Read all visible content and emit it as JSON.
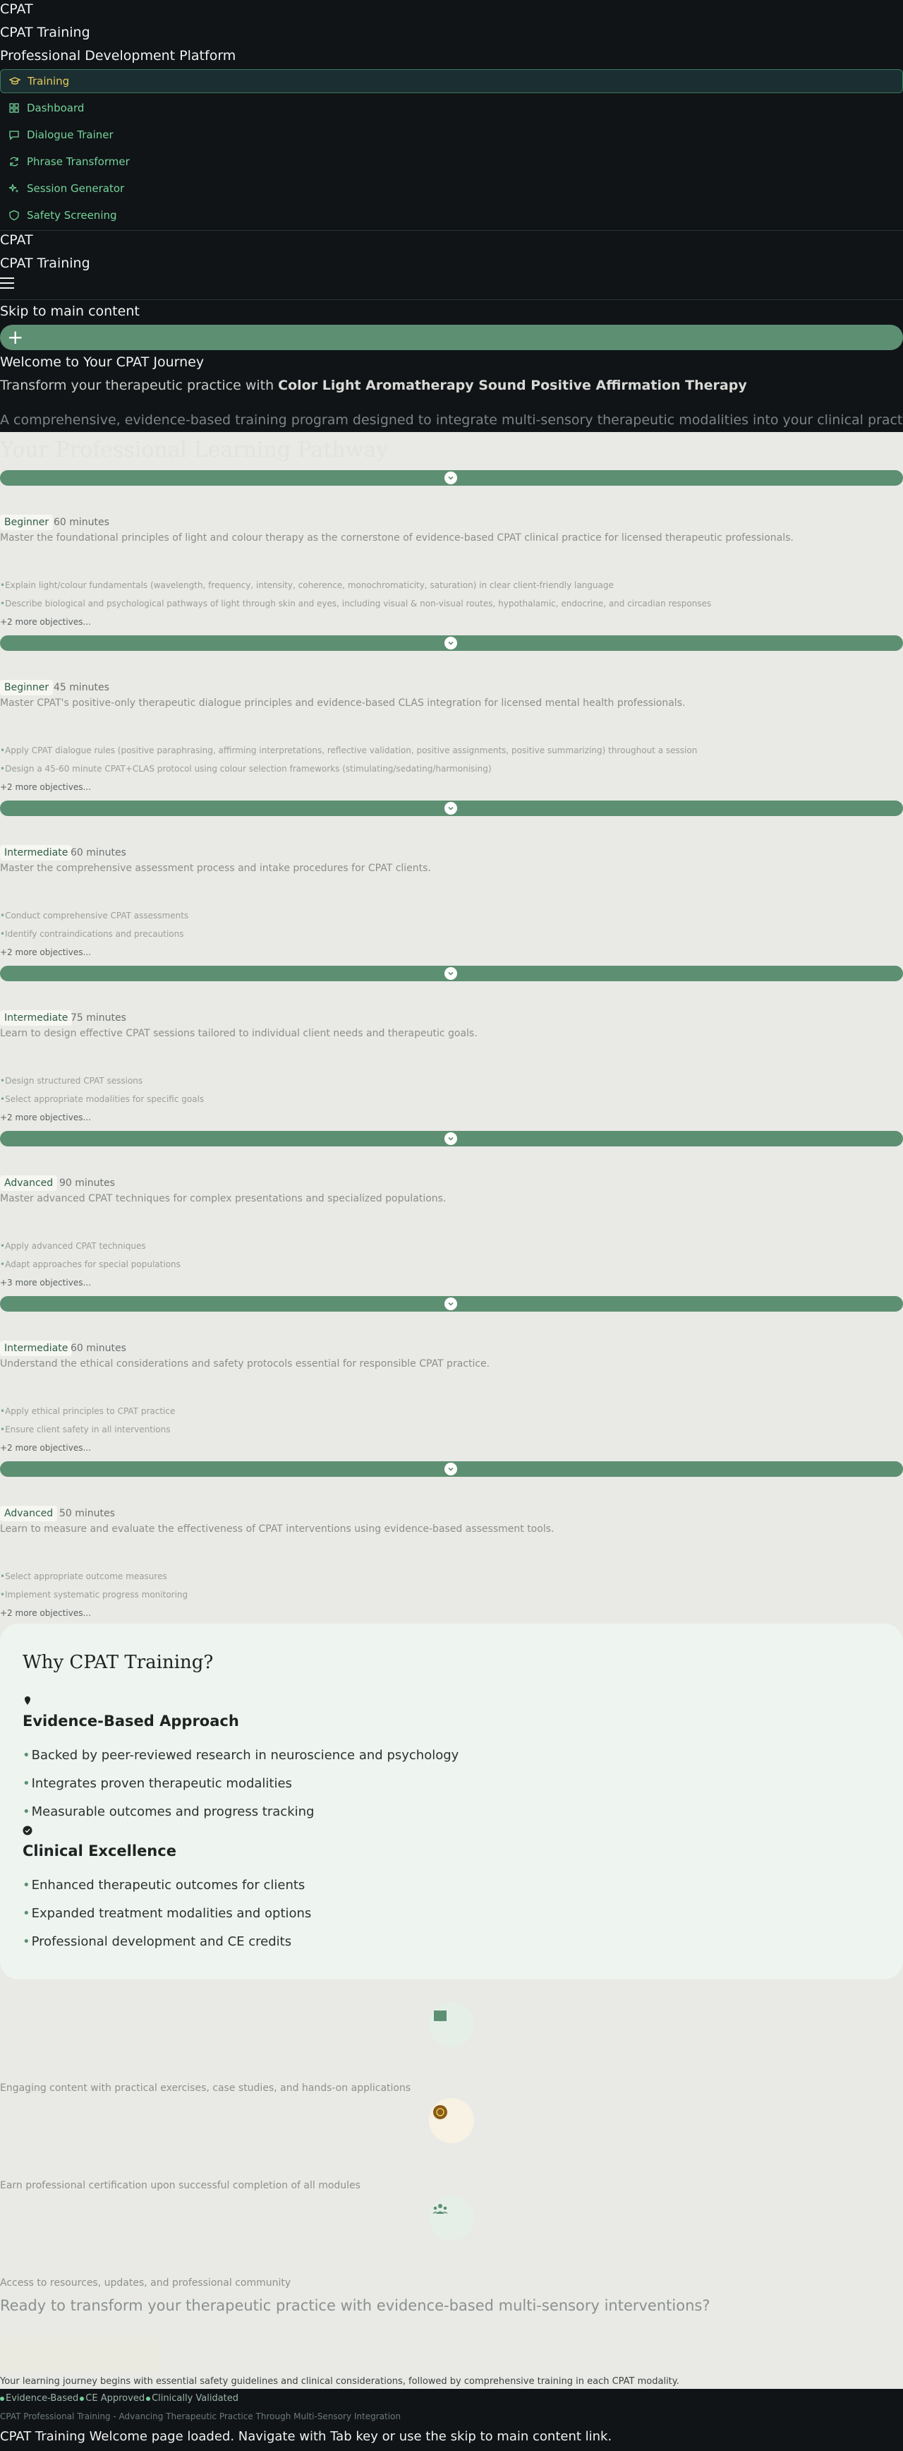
{
  "sidebar": {
    "brand": "CPAT",
    "title": "CPAT Training",
    "subtitle": "Professional Development Platform",
    "nav": [
      {
        "label": "Training",
        "icon": "graduation-cap-icon",
        "active": true
      },
      {
        "label": "Dashboard",
        "icon": "dashboard-grid-icon",
        "active": false
      },
      {
        "label": "Dialogue Trainer",
        "icon": "chat-bubble-icon",
        "active": false
      },
      {
        "label": "Phrase Transformer",
        "icon": "refresh-icon",
        "active": false
      },
      {
        "label": "Session Generator",
        "icon": "sparkles-icon",
        "active": false
      },
      {
        "label": "Safety Screening",
        "icon": "shield-icon",
        "active": false
      }
    ]
  },
  "header": {
    "brand": "CPAT",
    "title": "CPAT Training",
    "menu_icon": "hamburger-icon"
  },
  "skip_link": "Skip to main content",
  "hero": {
    "add_icon": "plus-icon",
    "title": "Welcome to Your CPAT Journey",
    "subtitle_prefix": "Transform your therapeutic practice with ",
    "subtitle_strong": "Color Light Aromatherapy Sound Positive Affirmation Therapy",
    "description": "A comprehensive, evidence-based training program designed to integrate multi-sensory therapeutic modalities into your clinical practice",
    "section_heading": "Your Professional Learning Pathway"
  },
  "modules": [
    {
      "level": "Beginner",
      "duration": "60 minutes",
      "description": "Master the foundational principles of light and colour therapy as the cornerstone of evidence-based CPAT clinical practice for licensed therapeutic professionals.",
      "objectives": [
        "Explain light/colour fundamentals (wavelength, frequency, intensity, coherence, monochromaticity, saturation) in clear client-friendly language",
        "Describe biological and psychological pathways of light through skin and eyes, including visual & non-visual routes, hypothalamic, endocrine, and circadian responses"
      ],
      "more": "+2 more objectives..."
    },
    {
      "level": "Beginner",
      "duration": "45 minutes",
      "description": "Master CPAT's positive-only therapeutic dialogue principles and evidence-based CLAS integration for licensed mental health professionals.",
      "objectives": [
        "Apply CPAT dialogue rules (positive paraphrasing, affirming interpretations, reflective validation, positive assignments, positive summarizing) throughout a session",
        "Design a 45-60 minute CPAT+CLAS protocol using colour selection frameworks (stimulating/sedating/harmonising)"
      ],
      "more": "+2 more objectives..."
    },
    {
      "level": "Intermediate",
      "duration": "60 minutes",
      "description": "Master the comprehensive assessment process and intake procedures for CPAT clients.",
      "objectives": [
        "Conduct comprehensive CPAT assessments",
        "Identify contraindications and precautions"
      ],
      "more": "+2 more objectives..."
    },
    {
      "level": "Intermediate",
      "duration": "75 minutes",
      "description": "Learn to design effective CPAT sessions tailored to individual client needs and therapeutic goals.",
      "objectives": [
        "Design structured CPAT sessions",
        "Select appropriate modalities for specific goals"
      ],
      "more": "+2 more objectives..."
    },
    {
      "level": "Advanced",
      "duration": "90 minutes",
      "description": "Master advanced CPAT techniques for complex presentations and specialized populations.",
      "objectives": [
        "Apply advanced CPAT techniques",
        "Adapt approaches for special populations"
      ],
      "more": "+3 more objectives..."
    },
    {
      "level": "Intermediate",
      "duration": "60 minutes",
      "description": "Understand the ethical considerations and safety protocols essential for responsible CPAT practice.",
      "objectives": [
        "Apply ethical principles to CPAT practice",
        "Ensure client safety in all interventions"
      ],
      "more": "+2 more objectives..."
    },
    {
      "level": "Advanced",
      "duration": "50 minutes",
      "description": "Learn to measure and evaluate the effectiveness of CPAT interventions using evidence-based assessment tools.",
      "objectives": [
        "Select appropriate outcome measures",
        "Implement systematic progress monitoring"
      ],
      "more": "+2 more objectives..."
    }
  ],
  "why": {
    "title": "Why CPAT Training?",
    "groups": [
      {
        "icon": "pin-icon",
        "heading": "Evidence-Based Approach",
        "items": [
          "Backed by peer-reviewed research in neuroscience and psychology",
          "Integrates proven therapeutic modalities",
          "Measurable outcomes and progress tracking"
        ]
      },
      {
        "icon": "check-circle-icon",
        "heading": "Clinical Excellence",
        "items": [
          "Enhanced therapeutic outcomes for clients",
          "Expanded treatment modalities and options",
          "Professional development and CE credits"
        ]
      }
    ]
  },
  "features": [
    {
      "icon": "book-icon",
      "description": "Engaging content with practical exercises, case studies, and hands-on applications",
      "color": "#5d8f72",
      "bg": "#e5efe8"
    },
    {
      "icon": "medal-icon",
      "description": "Earn professional certification upon successful completion of all modules",
      "color": "#8a5a16",
      "bg": "#f8f2e4"
    },
    {
      "icon": "people-icon",
      "description": "Access to resources, updates, and professional community",
      "color": "#5d8f72",
      "bg": "#e5efe8"
    }
  ],
  "cta": {
    "text": "Ready to transform your therapeutic practice with evidence-based multi-sensory interventions?",
    "journey_note": "Your learning journey begins with essential safety guidelines and clinical considerations, followed by comprehensive training in each CPAT modality."
  },
  "footer": {
    "trust": [
      "Evidence-Based",
      "CE Approved",
      "Clinically Validated"
    ],
    "copyright": "CPAT Professional Training - Advancing Therapeutic Practice Through Multi-Sensory Integration",
    "announcement": "CPAT Training Welcome page loaded. Navigate with Tab key or use the skip to main content link."
  },
  "colors": {
    "sidebar_bg": "#101417",
    "accent_green": "#5d8f72",
    "nav_green": "#74d39a",
    "active_gold": "#e5c95b",
    "page_bg": "#e9e9e6"
  }
}
